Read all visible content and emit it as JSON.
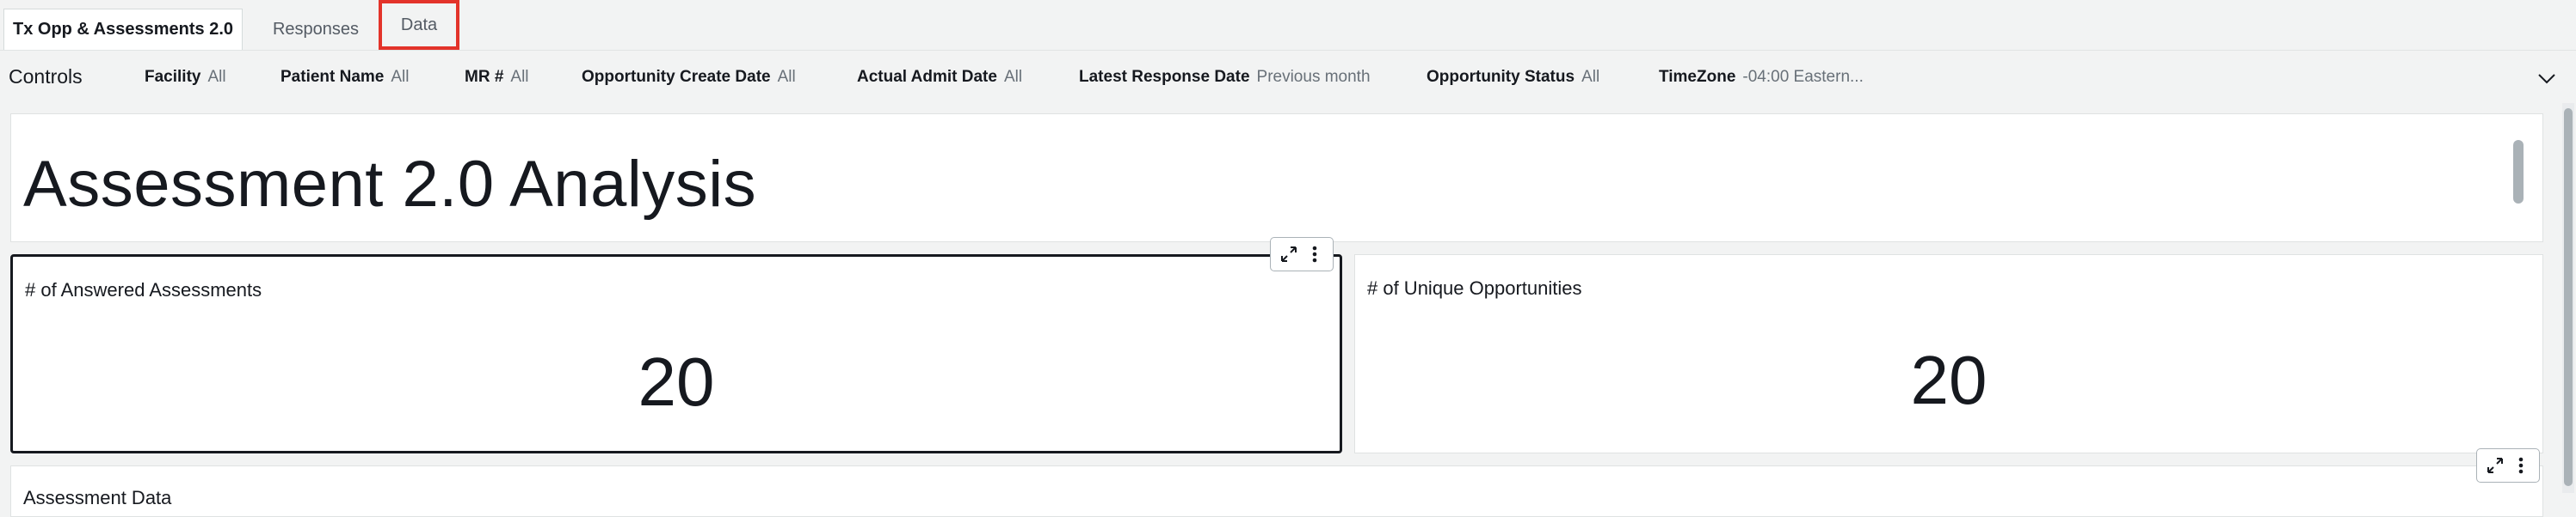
{
  "tabs": [
    {
      "label": "Tx Opp & Assessments 2.0"
    },
    {
      "label": "Responses"
    },
    {
      "label": "Data"
    }
  ],
  "controls": {
    "label": "Controls",
    "filters": [
      {
        "key": "Facility",
        "value": "All"
      },
      {
        "key": "Patient Name",
        "value": "All"
      },
      {
        "key": "MR #",
        "value": "All"
      },
      {
        "key": "Opportunity Create Date",
        "value": "All"
      },
      {
        "key": "Actual Admit Date",
        "value": "All"
      },
      {
        "key": "Latest Response Date",
        "value": "Previous month"
      },
      {
        "key": "Opportunity Status",
        "value": "All"
      },
      {
        "key": "TimeZone",
        "value": "-04:00 Eastern..."
      }
    ]
  },
  "sheet": {
    "title": "Assessment 2.0 Analysis",
    "kpis": [
      {
        "label": "# of Answered Assessments",
        "value": "20"
      },
      {
        "label": "# of Unique Opportunities",
        "value": "20"
      }
    ],
    "bottom_visual_title": "Assessment Data"
  },
  "icons": {
    "expand": "expand-icon",
    "more": "more-vertical-icon",
    "chevron": "chevron-down-icon"
  },
  "colors": {
    "highlight_box": "#e3332a",
    "selected_border": "#16191f"
  }
}
